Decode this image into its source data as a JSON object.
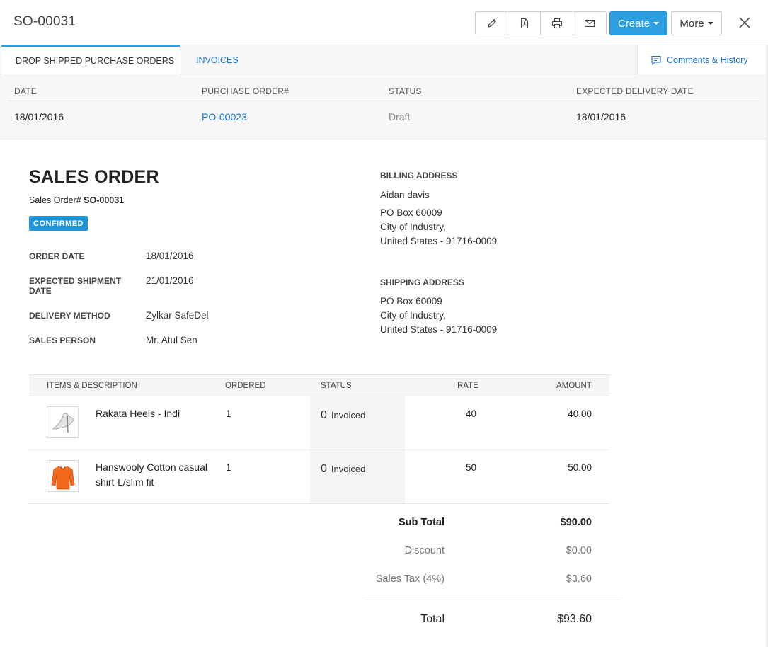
{
  "header": {
    "title": "SO-00031",
    "create_label": "Create",
    "more_label": "More"
  },
  "tabs": {
    "drop_shipped": "DROP SHIPPED PURCHASE ORDERS",
    "invoices": "INVOICES",
    "comments": "Comments & History"
  },
  "po_table": {
    "headers": [
      "DATE",
      "PURCHASE ORDER#",
      "STATUS",
      "EXPECTED DELIVERY DATE"
    ],
    "row": {
      "date": "18/01/2016",
      "po_number": "PO-00023",
      "status": "Draft",
      "expected_delivery": "18/01/2016"
    }
  },
  "sales_order": {
    "heading": "SALES ORDER",
    "number_label": "Sales Order#",
    "number": "SO-00031",
    "status_badge": "CONFIRMED",
    "details": {
      "order_date_label": "ORDER DATE",
      "order_date": "18/01/2016",
      "expected_shipment_label_1": "EXPECTED SHIPMENT",
      "expected_shipment_label_2": "DATE",
      "expected_shipment": "21/01/2016",
      "delivery_method_label": "DELIVERY METHOD",
      "delivery_method": "Zylkar SafeDel",
      "sales_person_label": "SALES PERSON",
      "sales_person": "Mr. Atul Sen"
    },
    "billing": {
      "label": "BILLING ADDRESS",
      "name": "Aidan davis",
      "line1": "PO Box 60009",
      "line2": "City of Industry,",
      "line3": "United States - 91716-0009"
    },
    "shipping": {
      "label": "SHIPPING ADDRESS",
      "line1": "PO Box 60009",
      "line2": "City of Industry,",
      "line3": "United States - 91716-0009"
    }
  },
  "items": {
    "headers": {
      "description": "ITEMS & DESCRIPTION",
      "ordered": "ORDERED",
      "status": "STATUS",
      "rate": "RATE",
      "amount": "AMOUNT"
    },
    "rows": [
      {
        "name": "Rakata Heels - Indi",
        "ordered": "1",
        "invoiced_count": "0",
        "invoiced_label": "Invoiced",
        "rate": "40",
        "amount": "40.00",
        "image": "heel-shoe-icon"
      },
      {
        "name": "Hanswooly Cotton casual shirt-L/slim fit",
        "ordered": "1",
        "invoiced_count": "0",
        "invoiced_label": "Invoiced",
        "rate": "50",
        "amount": "50.00",
        "image": "orange-sweater-icon"
      }
    ]
  },
  "totals": {
    "sub_total_label": "Sub Total",
    "sub_total": "$90.00",
    "discount_label": "Discount",
    "discount": "$0.00",
    "tax_label": "Sales Tax (4%)",
    "tax": "$3.60",
    "total_label": "Total",
    "total": "$93.60"
  },
  "colors": {
    "accent": "#2d9ee0",
    "link": "#1a73c9",
    "badge": "#1f95d9"
  }
}
